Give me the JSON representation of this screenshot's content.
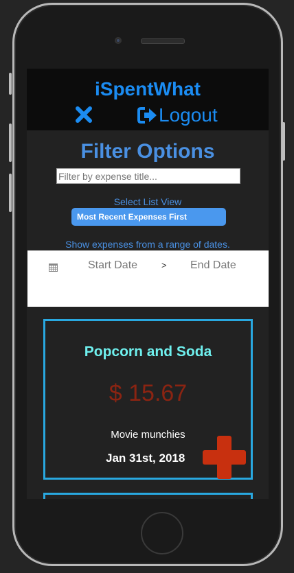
{
  "header": {
    "app_title": "iSpentWhat",
    "close_icon": "close-x-icon",
    "logout_label": "Logout",
    "logout_icon": "sign-out-icon"
  },
  "filters": {
    "title": "Filter Options",
    "search_placeholder": "Filter by expense title...",
    "list_view_label": "Select List View",
    "list_view_selected": "Most Recent Expenses First",
    "date_range_label": "Show expenses from a range of dates.",
    "calendar_icon": "calendar-icon",
    "start_date_placeholder": "Start Date",
    "date_separator": ">",
    "end_date_placeholder": "End Date"
  },
  "expenses": [
    {
      "title": "Popcorn and Soda",
      "amount": "$ 15.67",
      "description": "Movie munchies",
      "date": "Jan 31st, 2018"
    }
  ],
  "actions": {
    "add_icon": "plus-icon"
  },
  "colors": {
    "accent_blue": "#1b8cf2",
    "filter_blue": "#4a90e2",
    "card_border": "#29a8e0",
    "card_title": "#6ff0ee",
    "amount_red": "#8b2412",
    "add_button_red": "#c8300f"
  }
}
